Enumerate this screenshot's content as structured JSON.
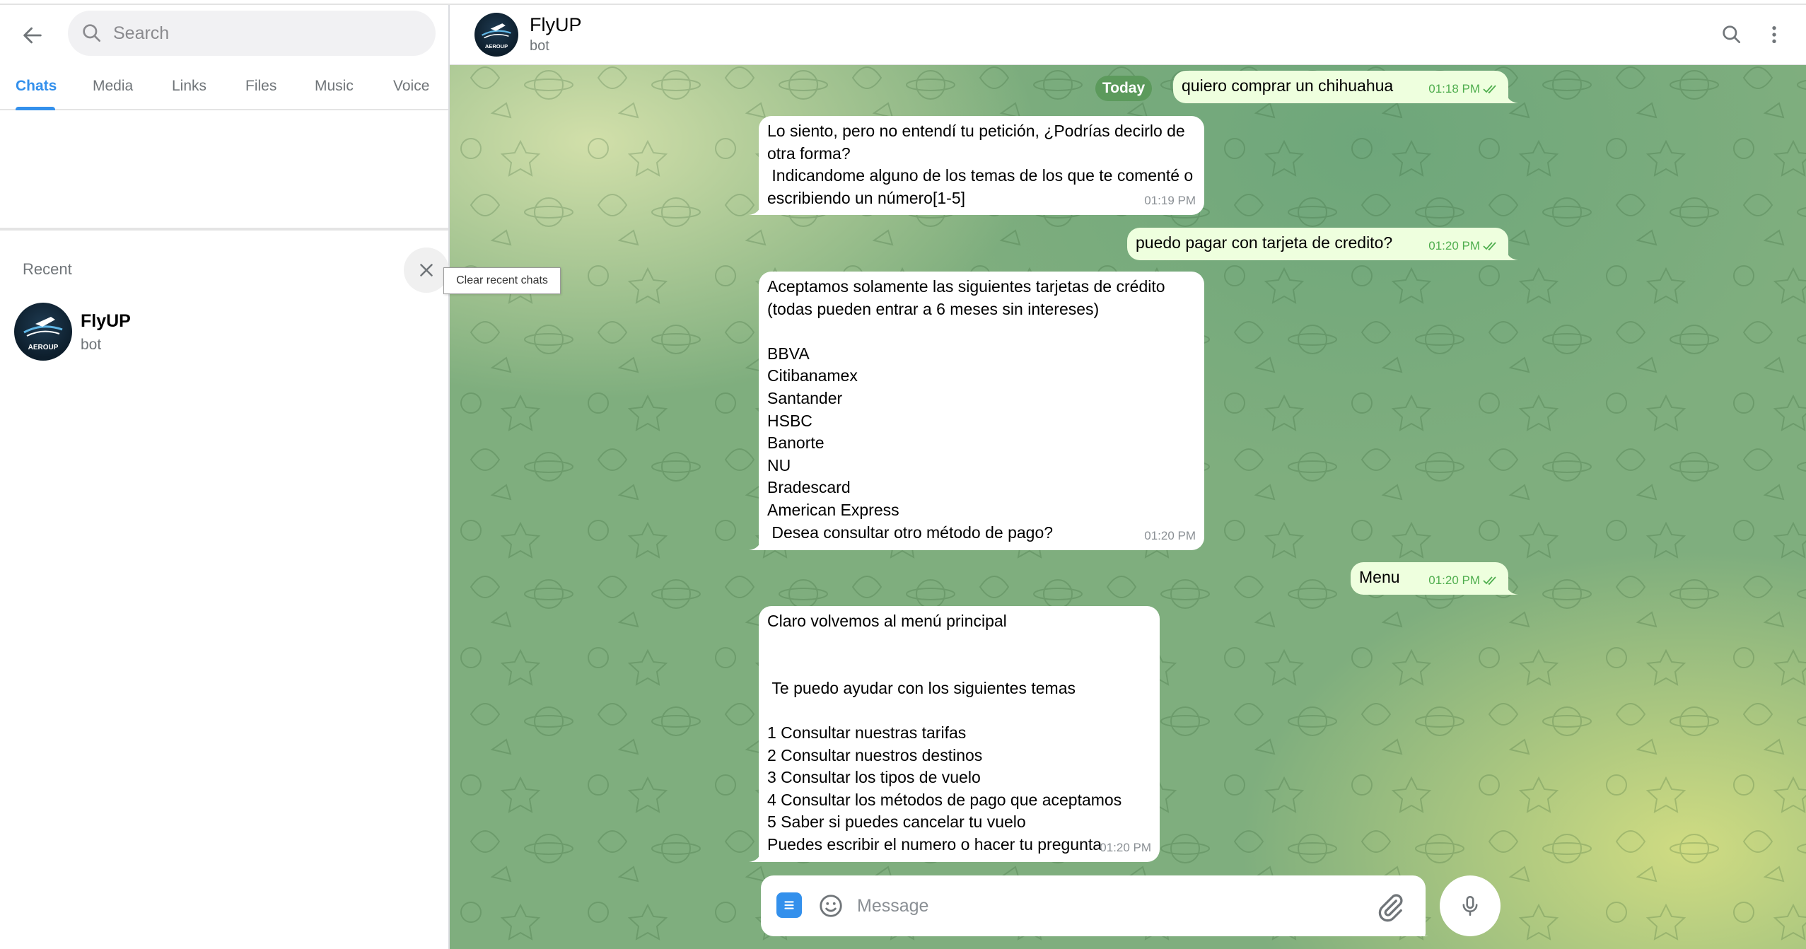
{
  "search": {
    "placeholder": "Search"
  },
  "tabs": [
    {
      "label": "Chats",
      "active": true
    },
    {
      "label": "Media"
    },
    {
      "label": "Links"
    },
    {
      "label": "Files"
    },
    {
      "label": "Music"
    },
    {
      "label": "Voice"
    }
  ],
  "recent": {
    "title": "Recent",
    "clear_tooltip": "Clear recent chats",
    "items": [
      {
        "name": "FlyUP",
        "subtitle": "bot",
        "avatar_text": "AEROUP"
      }
    ]
  },
  "chat": {
    "title": "FlyUP",
    "status": "bot",
    "date_label": "Today",
    "messages": [
      {
        "direction": "out",
        "text": "quiero comprar un chihuahua",
        "time": "01:18 PM",
        "read": true
      },
      {
        "direction": "in",
        "text": "Lo siento, pero no entendí tu petición, ¿Podrías decirlo de otra forma?\n Indicandome alguno de los temas de los que te comenté o escribiendo un número[1-5]",
        "time": "01:19 PM"
      },
      {
        "direction": "out",
        "text": "puedo pagar con tarjeta de credito?",
        "time": "01:20 PM",
        "read": true
      },
      {
        "direction": "in",
        "text": "Aceptamos solamente las siguientes tarjetas de crédito (todas pueden entrar a 6 meses sin intereses)\n\nBBVA\nCitibanamex\nSantander\nHSBC\nBanorte\nNU\nBradescard\nAmerican Express\n Desea consultar otro método de pago?",
        "time": "01:20 PM"
      },
      {
        "direction": "out",
        "text": "Menu",
        "time": "01:20 PM",
        "read": true
      },
      {
        "direction": "in",
        "text": "Claro volvemos al menú principal\n\n\n Te puedo ayudar con los siguientes temas\n\n1 Consultar nuestras tarifas\n2 Consultar nuestros destinos\n3 Consultar los tipos de vuelo\n4 Consultar los métodos de pago que aceptamos\n5 Saber si puedes cancelar tu vuelo\nPuedes escribir el numero o hacer tu pregunta",
        "time": "01:20 PM"
      }
    ]
  },
  "composer": {
    "placeholder": "Message"
  },
  "colors": {
    "accent": "#3390ec",
    "outgoing_bubble": "#eeffde",
    "incoming_bubble": "#ffffff",
    "date_pill": "#5c9a5c",
    "check_marks": "#4fae4e"
  },
  "icons": [
    "back-arrow-icon",
    "search-icon",
    "close-icon",
    "more-vertical-icon",
    "menu-icon",
    "emoji-icon",
    "attach-icon",
    "microphone-icon",
    "double-check-icon"
  ]
}
